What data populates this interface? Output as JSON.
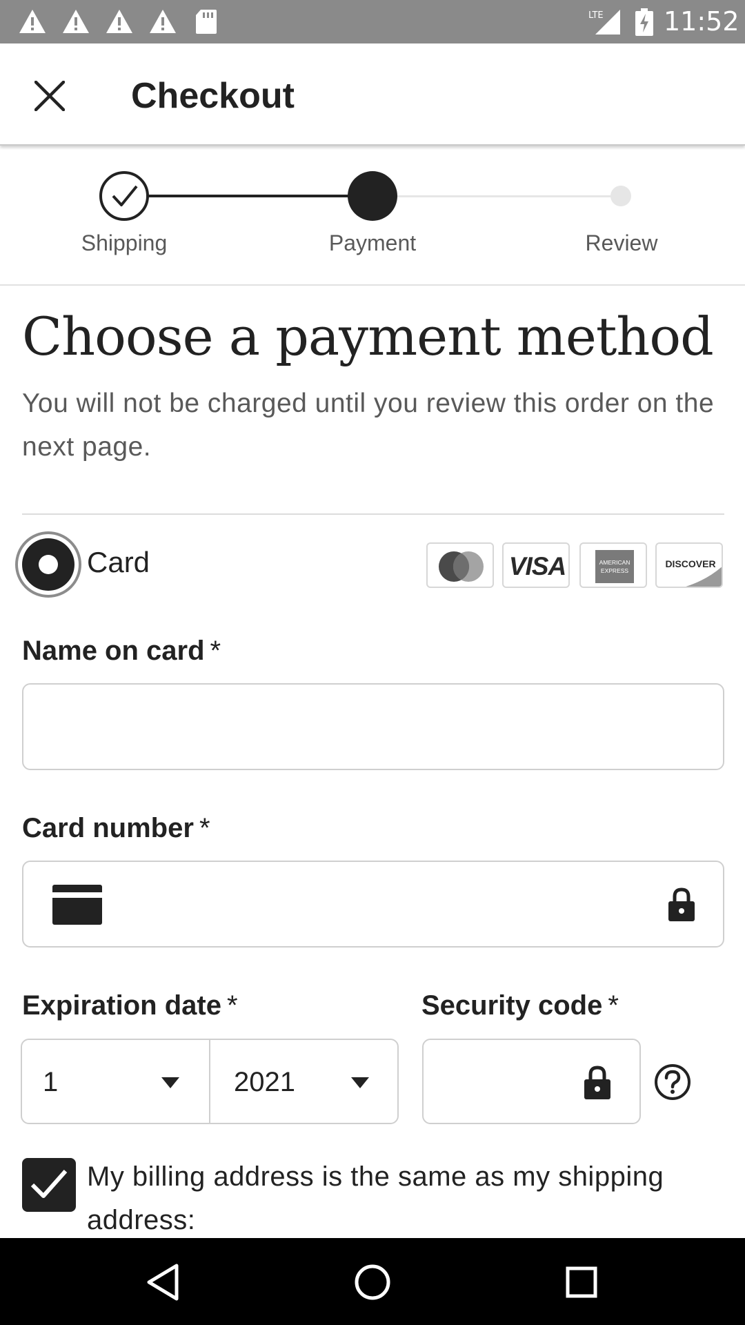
{
  "status_bar": {
    "time": "11:52",
    "network": "LTE",
    "icons": [
      "warning-icon",
      "warning-icon",
      "warning-icon",
      "warning-icon",
      "sd-card-icon",
      "lte-signal-icon",
      "battery-charging-icon"
    ]
  },
  "header": {
    "title": "Checkout",
    "close_icon": "close-icon"
  },
  "stepper": {
    "steps": [
      {
        "label": "Shipping",
        "state": "completed"
      },
      {
        "label": "Payment",
        "state": "current"
      },
      {
        "label": "Review",
        "state": "upcoming"
      }
    ]
  },
  "main": {
    "heading": "Choose a payment method",
    "subtext": "You will not be charged until you review this order on the next page."
  },
  "payment_option": {
    "label": "Card",
    "selected": true,
    "card_brands": [
      "Mastercard",
      "VISA",
      "AMERICAN EXPRESS",
      "DISCOVER"
    ]
  },
  "form": {
    "name_on_card": {
      "label": "Name on card",
      "required_mark": "*",
      "value": ""
    },
    "card_number": {
      "label": "Card number",
      "required_mark": "*",
      "value": ""
    },
    "expiration": {
      "label": "Expiration date",
      "required_mark": "*",
      "month": "1",
      "year": "2021"
    },
    "security_code": {
      "label": "Security code",
      "required_mark": "*",
      "value": ""
    },
    "billing_same": {
      "checked": true,
      "label": "My billing address is the same as my shipping address:"
    }
  },
  "colors": {
    "status_bar": "#8a8a8a",
    "primary_text": "#222222",
    "secondary_text": "#595959",
    "nav_bar": "#000000"
  }
}
